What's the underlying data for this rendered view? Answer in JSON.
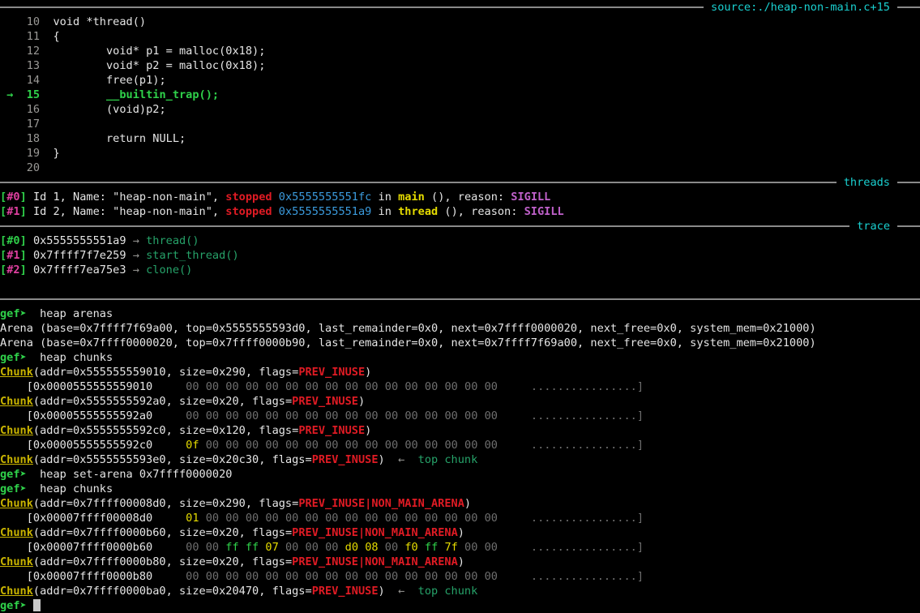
{
  "window": {
    "title": "gef source/threads/trace heap view",
    "bg": "#000000",
    "fg": "#cfcfcf"
  },
  "colors": {
    "accent_cyan": "#1ad1d1",
    "prompt_green": "#2fd14a",
    "flag_red": "#e01b24",
    "chunk_yellow": "#c9b400",
    "addr_blue": "#3b9bdd",
    "sigill_magenta": "#c061cb",
    "rule_gray": "#8a8a8a",
    "byte_zero_gray": "#6e6e6e"
  },
  "sections": {
    "source": {
      "label": "source:./heap-non-main.c+15"
    },
    "threads": {
      "label": "threads"
    },
    "trace": {
      "label": "trace"
    },
    "plain_rule": {
      "label": ""
    }
  },
  "source_view": {
    "current_line": "15",
    "arrow": "→",
    "lines": [
      {
        "no": "10",
        "code": "void *thread()"
      },
      {
        "no": "11",
        "code": "{"
      },
      {
        "no": "12",
        "code": "        void* p1 = malloc(0x18);"
      },
      {
        "no": "13",
        "code": "        void* p2 = malloc(0x18);"
      },
      {
        "no": "14",
        "code": "        free(p1);"
      },
      {
        "no": "15",
        "code": "        __builtin_trap();"
      },
      {
        "no": "16",
        "code": "        (void)p2;"
      },
      {
        "no": "17",
        "code": ""
      },
      {
        "no": "18",
        "code": "        return NULL;"
      },
      {
        "no": "19",
        "code": "}"
      },
      {
        "no": "20",
        "code": ""
      }
    ]
  },
  "threads": [
    {
      "frame": "#0",
      "id_text": "Id 1, Name: ",
      "name": "\"heap-non-main\"",
      "state": "stopped",
      "addr": "0x5555555551fc",
      "in": "in",
      "func": "main",
      "parens": "()",
      "reason_label": "reason:",
      "reason": "SIGILL"
    },
    {
      "frame": "#1",
      "id_text": "Id 2, Name: ",
      "name": "\"heap-non-main\"",
      "state": "stopped",
      "addr": "0x5555555551a9",
      "in": "in",
      "func": "thread",
      "parens": "()",
      "reason_label": "reason:",
      "reason": "SIGILL"
    }
  ],
  "trace": [
    {
      "frame": "#0",
      "addr": "0x5555555551a9",
      "arrow": "→",
      "func": "thread()",
      "current": true
    },
    {
      "frame": "#1",
      "addr": "0x7ffff7f7e259",
      "arrow": "→",
      "func": "start_thread()",
      "current": false
    },
    {
      "frame": "#2",
      "addr": "0x7ffff7ea75e3",
      "arrow": "→",
      "func": "clone()",
      "current": false
    }
  ],
  "console": {
    "prompt": "gef➤",
    "commands": {
      "heap_arenas": "heap arenas",
      "heap_chunks": "heap chunks",
      "heap_set_arena": "heap set-arena 0x7ffff0000020"
    },
    "arenas": [
      "Arena (base=0x7ffff7f69a00, top=0x5555555593d0, last_remainder=0x0, next=0x7ffff0000020, next_free=0x0, system_mem=0x21000)",
      "Arena (base=0x7ffff0000020, top=0x7ffff0000b90, last_remainder=0x0, next=0x7ffff7f69a00, next_free=0x0, system_mem=0x21000)"
    ],
    "main_arena_chunks": [
      {
        "label": "Chunk",
        "addr": "0x555555559010",
        "size": "0x290",
        "flags": [
          "PREV_INUSE"
        ],
        "top": false,
        "dump": {
          "addr": "0x0000555555559010",
          "bytes": [
            "00",
            "00",
            "00",
            "00",
            "00",
            "00",
            "00",
            "00",
            "00",
            "00",
            "00",
            "00",
            "00",
            "00",
            "00",
            "00"
          ],
          "byte_colors": [
            "g",
            "g",
            "g",
            "g",
            "g",
            "g",
            "g",
            "g",
            "g",
            "g",
            "g",
            "g",
            "g",
            "g",
            "g",
            "g"
          ],
          "ascii": "................"
        }
      },
      {
        "label": "Chunk",
        "addr": "0x5555555592a0",
        "size": "0x20",
        "flags": [
          "PREV_INUSE"
        ],
        "top": false,
        "dump": {
          "addr": "0x00005555555592a0",
          "bytes": [
            "00",
            "00",
            "00",
            "00",
            "00",
            "00",
            "00",
            "00",
            "00",
            "00",
            "00",
            "00",
            "00",
            "00",
            "00",
            "00"
          ],
          "byte_colors": [
            "g",
            "g",
            "g",
            "g",
            "g",
            "g",
            "g",
            "g",
            "g",
            "g",
            "g",
            "g",
            "g",
            "g",
            "g",
            "g"
          ],
          "ascii": "................"
        }
      },
      {
        "label": "Chunk",
        "addr": "0x5555555592c0",
        "size": "0x120",
        "flags": [
          "PREV_INUSE"
        ],
        "top": false,
        "dump": {
          "addr": "0x00005555555592c0",
          "bytes": [
            "0f",
            "00",
            "00",
            "00",
            "00",
            "00",
            "00",
            "00",
            "00",
            "00",
            "00",
            "00",
            "00",
            "00",
            "00",
            "00"
          ],
          "byte_colors": [
            "y",
            "g",
            "g",
            "g",
            "g",
            "g",
            "g",
            "g",
            "g",
            "g",
            "g",
            "g",
            "g",
            "g",
            "g",
            "g"
          ],
          "ascii": "................"
        }
      },
      {
        "label": "Chunk",
        "addr": "0x5555555593e0",
        "size": "0x20c30",
        "flags": [
          "PREV_INUSE"
        ],
        "top": true,
        "top_arrow": "←",
        "top_label": "top chunk",
        "dump": null
      }
    ],
    "non_main_arena_chunks": [
      {
        "label": "Chunk",
        "addr": "0x7ffff00008d0",
        "size": "0x290",
        "flags": [
          "PREV_INUSE",
          "NON_MAIN_ARENA"
        ],
        "top": false,
        "dump": {
          "addr": "0x00007ffff00008d0",
          "bytes": [
            "01",
            "00",
            "00",
            "00",
            "00",
            "00",
            "00",
            "00",
            "00",
            "00",
            "00",
            "00",
            "00",
            "00",
            "00",
            "00"
          ],
          "byte_colors": [
            "y",
            "g",
            "g",
            "g",
            "g",
            "g",
            "g",
            "g",
            "g",
            "g",
            "g",
            "g",
            "g",
            "g",
            "g",
            "g"
          ],
          "ascii": "................"
        }
      },
      {
        "label": "Chunk",
        "addr": "0x7ffff0000b60",
        "size": "0x20",
        "flags": [
          "PREV_INUSE",
          "NON_MAIN_ARENA"
        ],
        "top": false,
        "dump": {
          "addr": "0x00007ffff0000b60",
          "bytes": [
            "00",
            "00",
            "ff",
            "ff",
            "07",
            "00",
            "00",
            "00",
            "d0",
            "08",
            "00",
            "f0",
            "ff",
            "7f",
            "00",
            "00"
          ],
          "byte_colors": [
            "g",
            "g",
            "n",
            "n",
            "y",
            "g",
            "g",
            "g",
            "y",
            "y",
            "g",
            "y",
            "n",
            "y",
            "g",
            "g"
          ],
          "ascii": "................"
        }
      },
      {
        "label": "Chunk",
        "addr": "0x7ffff0000b80",
        "size": "0x20",
        "flags": [
          "PREV_INUSE",
          "NON_MAIN_ARENA"
        ],
        "top": false,
        "dump": {
          "addr": "0x00007ffff0000b80",
          "bytes": [
            "00",
            "00",
            "00",
            "00",
            "00",
            "00",
            "00",
            "00",
            "00",
            "00",
            "00",
            "00",
            "00",
            "00",
            "00",
            "00"
          ],
          "byte_colors": [
            "g",
            "g",
            "g",
            "g",
            "g",
            "g",
            "g",
            "g",
            "g",
            "g",
            "g",
            "g",
            "g",
            "g",
            "g",
            "g"
          ],
          "ascii": "................"
        }
      },
      {
        "label": "Chunk",
        "addr": "0x7ffff0000ba0",
        "size": "0x20470",
        "flags": [
          "PREV_INUSE"
        ],
        "top": true,
        "top_arrow": "←",
        "top_label": "top chunk",
        "dump": null
      }
    ],
    "final_prompt": "gef➤"
  }
}
